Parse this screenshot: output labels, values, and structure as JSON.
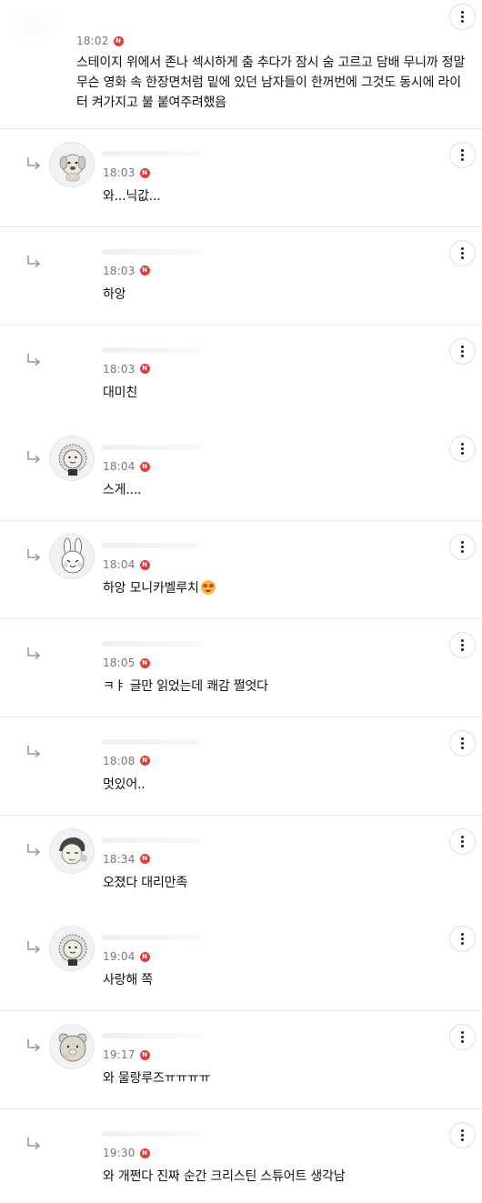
{
  "top_comment": {
    "time": "18:02",
    "badge": "N",
    "body": "스테이지 위에서 존나 섹시하게 춤 추다가 잠시 숨 고르고 담배 무니까 정말 무슨 영화 속 한장면처럼 밑에 있던 남자들이 한꺼번에 그것도 동시에 라이터 켜가지고 불 붙여주려했음"
  },
  "replies": [
    {
      "time": "18:03",
      "badge": "N",
      "body": "와...닉값...",
      "avatar": "dog-character-icon",
      "emoji": false
    },
    {
      "time": "18:03",
      "badge": "N",
      "body": "하앙",
      "avatar": "blank",
      "emoji": false
    },
    {
      "time": "18:03",
      "badge": "N",
      "body": "대미친",
      "avatar": "blank",
      "emoji": false
    },
    {
      "time": "18:04",
      "badge": "N",
      "body": "스게....",
      "avatar": "lion-character-icon",
      "emoji": false
    },
    {
      "time": "18:04",
      "badge": "N",
      "body": "하앙 모니카벨루치",
      "avatar": "rabbit-character-icon",
      "emoji": true
    },
    {
      "time": "18:05",
      "badge": "N",
      "body": "ㅋㅑ 글만 읽었는데 쾌감 쩔엇다",
      "avatar": "blank",
      "emoji": false
    },
    {
      "time": "18:08",
      "badge": "N",
      "body": "멋있어..",
      "avatar": "blank",
      "emoji": false
    },
    {
      "time": "18:34",
      "badge": "N",
      "body": "오졌다 대리만족",
      "avatar": "girl-character-icon",
      "emoji": false
    },
    {
      "time": "19:04",
      "badge": "N",
      "body": "사랑해 쪽",
      "avatar": "lion-character-icon",
      "emoji": false
    },
    {
      "time": "19:17",
      "badge": "N",
      "body": "와 물랑루즈ㅠㅠㅠㅠ",
      "avatar": "bear-character-icon",
      "emoji": false
    },
    {
      "time": "19:30",
      "badge": "N",
      "body": "와 개쩐다 진짜 순간 크리스틴 스튜어트 생각남",
      "avatar": "blank",
      "emoji": false
    }
  ],
  "icons": {
    "reply_arrow": "reply-arrow-icon",
    "more": "more-vertical-icon",
    "new_badge_color": "#e03b3b"
  }
}
